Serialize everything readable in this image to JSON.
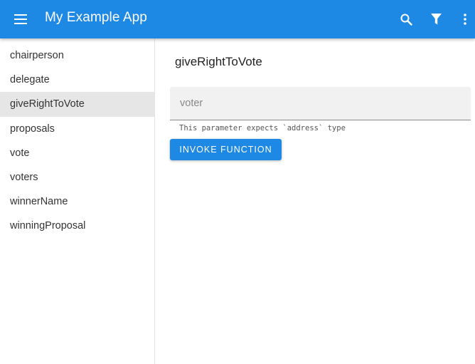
{
  "app": {
    "title": "My Example App",
    "accent_color": "#1e88e5",
    "icons": [
      "menu-icon",
      "search-icon",
      "filter-icon",
      "more-vert-icon"
    ]
  },
  "sidebar": {
    "items": [
      {
        "label": "chairperson"
      },
      {
        "label": "delegate"
      },
      {
        "label": "giveRightToVote",
        "active": true
      },
      {
        "label": "proposals"
      },
      {
        "label": "vote"
      },
      {
        "label": "voters"
      },
      {
        "label": "winnerName"
      },
      {
        "label": "winningProposal"
      }
    ]
  },
  "main": {
    "function_title": "giveRightToVote",
    "voter_field": {
      "placeholder": "voter",
      "value": ""
    },
    "hint": "This parameter expects `address` type",
    "invoke_label": "INVOKE FUNCTION"
  }
}
